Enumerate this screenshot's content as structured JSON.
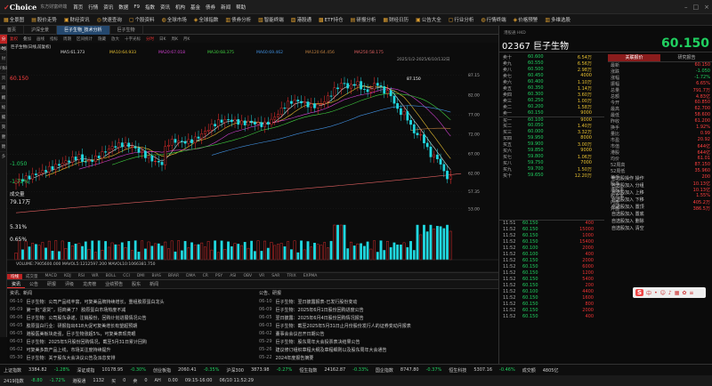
{
  "titlebar": {
    "brand": "Choice",
    "brand_sub": "东方财富终端",
    "menus": [
      "首页",
      "行情",
      "资讯",
      "数据",
      "F9",
      "指数",
      "资讯",
      "机构",
      "基金",
      "债券",
      "新闻",
      "帮助"
    ]
  },
  "toolbar": {
    "items": [
      "全景图",
      "股价走势",
      "财经资讯",
      "快速查询",
      "个股资料",
      "全球市场",
      "全球指数",
      "债券分析",
      "智能终端",
      "港股通",
      "ETF持仓",
      "研报分析",
      "财经日历",
      "公告大全",
      "行业分析",
      "行情终端",
      "价格预警",
      "多维选股"
    ]
  },
  "tabs": [
    "首页",
    "沪深全景",
    "巨子生物_技术分析",
    "巨子生物"
  ],
  "subtoolbar": [
    "复权",
    "叠加",
    "画线",
    "指标",
    "周期",
    "区间统计",
    "隐藏",
    "放大",
    "十字光标",
    "分时",
    "日K",
    "周K",
    "月K"
  ],
  "leftbar": [
    "分时",
    "K线",
    "财务",
    "F10",
    "资讯",
    "新闻",
    "指标",
    "论股",
    "成交",
    "资金",
    "对比",
    "更多"
  ],
  "chart": {
    "legend_left": "巨子生物(日线,前复权)",
    "ma5": "MA5:61.373",
    "ma10": "MA10:64.933",
    "ma20": "MA20:67.018",
    "ma30": "MA30:68.375",
    "ma60": "MA60:69.462",
    "ma120": "MA120:64.456",
    "ma250": "MA250:58.175",
    "date_range": "2025/1/2-2025/6/10/132日",
    "high_label": "87.150",
    "low_label": "57.350",
    "vol_label": "VOLUME:7905600.000  MAVOL5:1212597.200  MAVOL10:1066381.750"
  },
  "side": {
    "label1": "60.150",
    "label2": "-1.050",
    "label3": "-1.72%",
    "label4": "成交量",
    "label5": "79.17万",
    "label6": "5.31%",
    "label7": "0.65%"
  },
  "indicators": [
    "均线",
    "成交量",
    "MACD",
    "KDJ",
    "RSI",
    "WR",
    "BOLL",
    "CCI",
    "DMI",
    "BIAS",
    "BRAR",
    "DMA",
    "CR",
    "PSY",
    "ASI",
    "OBV",
    "VR",
    "SAR",
    "TRIX",
    "EXPMA"
  ],
  "news": {
    "tabs": [
      "资讯",
      "公告",
      "研报",
      "评级",
      "龙虎榜",
      "业绩预告",
      "股东",
      "新闻"
    ],
    "left_title": "资讯、新闻",
    "right_title": "公告、研报",
    "left": [
      {
        "d": "06-10",
        "t": "巨子生物：公司产品线丰富，可复美品牌持续增长，重组胶原蛋白龙头"
      },
      {
        "d": "06-09",
        "t": "第一批“退货”，招商美了？ 胶原蛋白市场热度不减"
      },
      {
        "d": "06-06",
        "t": "巨子生物：公司股东承诺，注销股份，回购计划进展情况公告"
      },
      {
        "d": "06-05",
        "t": "胶原蛋白行业：研报指出618大促可复美增长有望超预期"
      },
      {
        "d": "06-05",
        "t": "港股医美板块走强，巨子生物涨超5%，可复美表现亮眼"
      },
      {
        "d": "06-03",
        "t": "巨子生物：2025年5月股份回购情况，截至5月31日累计回购"
      },
      {
        "d": "06-02",
        "t": "可复美多款产品上线，市场关注度持续提升"
      },
      {
        "d": "05-30",
        "t": "巨子生物：关于股东大会决议公告及派息安排"
      }
    ],
    "right": [
      {
        "d": "06-10",
        "t": "巨子生物：翌日披露报表-已发行股份变动"
      },
      {
        "d": "06-09",
        "t": "巨子生物：2025年6月1日股份回购进度公告"
      },
      {
        "d": "06-05",
        "t": "翌日披露：2025年6月4日股份回购情况报告"
      },
      {
        "d": "06-03",
        "t": "巨子生物：截至2025年5月31日止月份股份发行人的证券变动月报表"
      },
      {
        "d": "06-02",
        "t": "董事会会议召开日期公告"
      },
      {
        "d": "05-29",
        "t": "巨子生物：股东周年大会投票表决结果公告"
      },
      {
        "d": "05-26",
        "t": "建议修订组织章程大纲及章程细则以及股东周年大会通告"
      },
      {
        "d": "05-22",
        "t": "2024年度报告摘要"
      }
    ]
  },
  "stock": {
    "code": "02367",
    "name": "巨子生物",
    "price": "60.150",
    "sub": "港股通 HKD"
  },
  "orderbook": {
    "asks": [
      [
        "卖十",
        "60.600",
        "6.54万"
      ],
      [
        "卖九",
        "60.550",
        "6.56万"
      ],
      [
        "卖八",
        "60.500",
        "2.98万"
      ],
      [
        "卖七",
        "60.450",
        "4000"
      ],
      [
        "卖六",
        "60.400",
        "1.10万"
      ],
      [
        "卖五",
        "60.350",
        "1.14万"
      ],
      [
        "卖四",
        "60.300",
        "3.60万"
      ],
      [
        "卖三",
        "60.250",
        "1.00万"
      ],
      [
        "卖二",
        "60.200",
        "1.58万"
      ],
      [
        "卖一",
        "60.150",
        "9000"
      ]
    ],
    "bids": [
      [
        "买一",
        "60.100",
        "9000"
      ],
      [
        "买二",
        "60.050",
        "1.40万"
      ],
      [
        "买三",
        "60.000",
        "3.32万"
      ],
      [
        "买四",
        "59.950",
        "8000"
      ],
      [
        "买五",
        "59.900",
        "3.00万"
      ],
      [
        "买六",
        "59.850",
        "9000"
      ],
      [
        "买七",
        "59.800",
        "1.06万"
      ],
      [
        "买八",
        "59.750",
        "7000"
      ],
      [
        "买九",
        "59.700",
        "1.50万"
      ],
      [
        "买十",
        "59.650",
        "12.20万"
      ]
    ]
  },
  "stats": {
    "tabs": [
      "关联报价",
      "研究报告"
    ],
    "rows": [
      [
        "最新",
        "60.150"
      ],
      [
        "涨跌",
        "-1.050"
      ],
      [
        "涨幅",
        "-1.72%"
      ],
      [
        "振幅",
        "6.65%"
      ],
      [
        "总量",
        "791.7万"
      ],
      [
        "总额",
        "4.83亿"
      ],
      [
        "今开",
        "60.850"
      ],
      [
        "最高",
        "62.700"
      ],
      [
        "最低",
        "58.600"
      ],
      [
        "昨收",
        "61.200"
      ],
      [
        "换手",
        "1.92%"
      ],
      [
        "量比",
        "0.99"
      ],
      [
        "市盈",
        "20.92"
      ],
      [
        "市值",
        "644亿"
      ],
      [
        "港股",
        "644亿"
      ],
      [
        "均价",
        "61.01"
      ],
      [
        "52周高",
        "87.150"
      ],
      [
        "52周低",
        "35.960"
      ],
      [
        "每手",
        "200"
      ],
      [
        "股本",
        "10.13亿"
      ],
      [
        "港股本",
        "10.13亿"
      ],
      [
        "股息率",
        "1.55%"
      ],
      [
        "内盘",
        "405.2万"
      ],
      [
        "外盘",
        "386.5万"
      ]
    ]
  },
  "sidemenu": [
    "自选股操作 操作",
    "自选股加入 分组",
    "自选股加入 上移",
    "自选股加入 下移",
    "自选股加入 置顶",
    "自选股加入 置底",
    "自选股加入 删除",
    "自选股加入 清空"
  ],
  "trades": [
    [
      "11:51",
      "60.150",
      "400"
    ],
    [
      "11:52",
      "60.150",
      "15000"
    ],
    [
      "11:52",
      "60.150",
      "1000"
    ],
    [
      "11:52",
      "60.150",
      "15400"
    ],
    [
      "11:52",
      "60.100",
      "2000"
    ],
    [
      "11:52",
      "60.100",
      "400"
    ],
    [
      "11:52",
      "60.150",
      "2000"
    ],
    [
      "11:52",
      "60.150",
      "6000"
    ],
    [
      "11:52",
      "60.150",
      "1200"
    ],
    [
      "11:52",
      "60.150",
      "5400"
    ],
    [
      "11:52",
      "60.150",
      "200"
    ],
    [
      "11:52",
      "60.100",
      "4400"
    ],
    [
      "11:52",
      "60.150",
      "1600"
    ],
    [
      "11:52",
      "60.150",
      "800"
    ],
    [
      "11:52",
      "60.150",
      "2000"
    ],
    [
      "11:52",
      "60.150",
      "400"
    ]
  ],
  "statusbar": {
    "row1": [
      "上证指数",
      "3384.82",
      "-1.28%",
      "深证成指",
      "10178.95",
      "-0.30%",
      "创业板指",
      "2060.41",
      "-0.35%",
      "沪深300",
      "3873.98",
      "-0.27%",
      "恒生指数",
      "24162.87",
      "-0.33%",
      "国企指数",
      "8747.80",
      "-0.37%",
      "恒生科技",
      "5307.16",
      "-0.46%",
      "成交额",
      "4805亿"
    ],
    "row2": [
      "2419指数",
      "-8.80",
      "-1.72%",
      "港股通",
      "1132",
      "买",
      "0",
      "卖",
      "0",
      "AH",
      "0.00",
      "09:15-16:00",
      "06/10 11:52:29"
    ]
  }
}
